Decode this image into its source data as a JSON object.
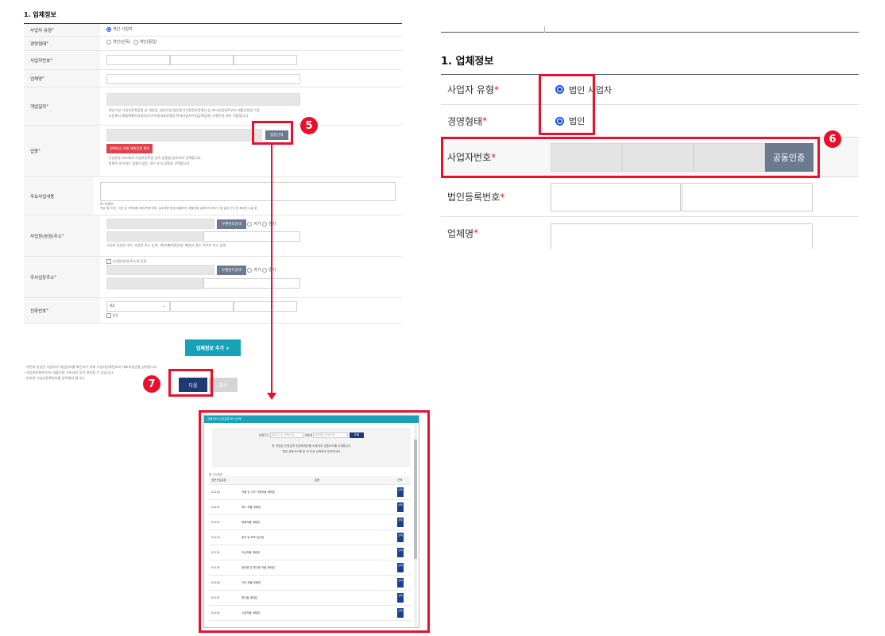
{
  "left_form": {
    "title": "1. 업체정보",
    "rows": {
      "biz_type": {
        "label": "사업자 유형",
        "option": "개인 사업자"
      },
      "mgmt_type": {
        "label": "경영형태",
        "option1": "개인(단독)",
        "option2": "개인(동업)"
      },
      "biz_no": {
        "label": "사업자번호"
      },
      "company": {
        "label": "업체명"
      },
      "opening": {
        "label": "개업일자",
        "note1": "· 개인기업 사업자등록증명 상 개업일, 법인기업 법인등기사항전부증명서 상 회사성립일로부터 대출신청일 기준",
        "note2": "· 오등록시 매출액확인서류(부가가치세과표증명원,면세사업자수입금액증명) 시행인과 회이 적합합니다."
      },
      "industry": {
        "label": "업종",
        "select_btn": "업종선택",
        "red_btn": "정책자금 지원 제외업종 확인",
        "note1": "· 산업분류 코드에서 사업자등록증 상의 업종을 참조하여 선택합니다.",
        "note2": "· 정확히 일치하는 업종이 없는 경우 유사 업종을 선택합니다."
      },
      "main_biz": {
        "label": "주요사업내용",
        "counter": "0/ 1000",
        "hint": "작성 예) 치킨, 가방 등 가죽제품 제조/판매 하며, 설비개량 등에 대출하며, 제품개발 설명하게 하이기 및 일본,가지 등 확대의 수출 중"
      },
      "biz_addr": {
        "label": "사업장(본점)주소",
        "zip_btn": "우편번호검색",
        "own": "자가",
        "rent": "임차",
        "note": "사업자 휴업인 경우 사업장 주소 입력, 개인(폐하였업자) 폐업인 경우 거주지 주소 입력"
      },
      "main_addr": {
        "label": "주사업장주소",
        "same": "사업장(본점)주소와 동일",
        "zip_btn": "우편번호검색",
        "own": "자가",
        "rent": "임차"
      },
      "phone": {
        "label": "전화번호",
        "area": "02",
        "none": "없음"
      }
    },
    "add_btn": "업체정보 추가 +",
    "bottom_notes": [
      "· 기존에 동일한 사업자의 개업일자를 확인하기 위해 사업자등록번호와 대표자생년을 입력합니다.",
      "· 사업자유형에 따라 대출신청 구비서류 등이 달라질 수 있습니다.",
      "· 유효한 사업자등록번호를 입력해야 합니다."
    ],
    "next_btn": "다음",
    "cancel_btn": "취소"
  },
  "badges": {
    "b5": "5",
    "b6": "6",
    "b7": "7"
  },
  "right_form": {
    "title": "1. 업체정보",
    "biz_type_label": "사업자 유형",
    "biz_type_option": "법인 사업자",
    "mgmt_label": "경영형태",
    "mgmt_option": "법인",
    "biz_no_label": "사업자번호",
    "cert_btn": "공동인증",
    "corp_no_label": "법인등록번호",
    "company_label": "업체명"
  },
  "popup": {
    "title": "업종코드(산업분류코드)선택",
    "search_code_label": "업종코드",
    "search_code_placeholder": "업종코드를 입력하세요",
    "search_name_label": "업종명",
    "search_name_placeholder": "업종명을 입력하세요",
    "search_btn": "조회",
    "info1": "총 개정된 산업분류 업종체계표를 이용하여 업종코드를 조회합니다",
    "info2": "해당 업종코드를 한 개 이상 선택하여 입력하세요",
    "count": "총 1,094건",
    "col_code": "표준산업분류",
    "col_name": "업종",
    "col_sel": "선택",
    "sel_label": "선택",
    "rows": [
      {
        "code": "01110",
        "name": "곡물 및 기타 식량작물 재배업"
      },
      {
        "code": "01121",
        "name": "채소 작물 재배업"
      },
      {
        "code": "01122",
        "name": "화훼작물 재배업"
      },
      {
        "code": "01123",
        "name": "종자 및 묘목 생산업"
      },
      {
        "code": "01131",
        "name": "과실작물 재배업"
      },
      {
        "code": "01132",
        "name": "음료용 및 향신용 작물 재배업"
      },
      {
        "code": "01140",
        "name": "기타 작물 재배업"
      },
      {
        "code": "01151",
        "name": "콩나물 재배업"
      },
      {
        "code": "01152",
        "name": "시설작물 재배업"
      }
    ]
  }
}
